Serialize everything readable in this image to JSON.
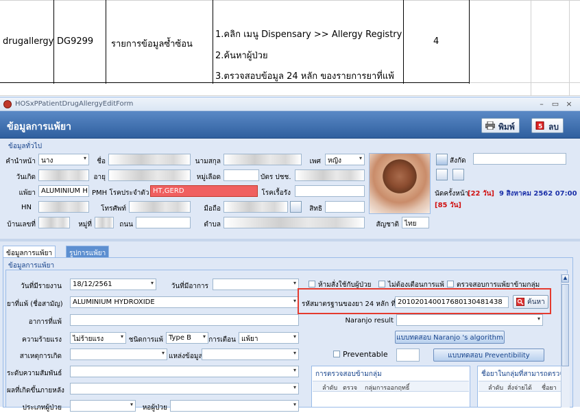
{
  "sheet": {
    "row": {
      "code": "drugallergy",
      "id": "DG9299",
      "description": "รายการข้อมูลซ้ำซ้อน",
      "steps": [
        "1.คลิก เมนู Dispensary >> Allergy Registry",
        "2.ค้นหาผู้ป่วย",
        "3.ตรวจสอบข้อมูล 24 หลัก ของรายการยาที่แพ้"
      ],
      "count": "4"
    }
  },
  "window": {
    "title": "HOSxPPatientDrugAllergyEditForm",
    "controls": {
      "minimize": "–",
      "maximize": "▭",
      "close": "×"
    }
  },
  "header": {
    "title": "ข้อมูลการแพ้ยา",
    "print_label": "พิมพ์",
    "delete_label": "ลบ"
  },
  "general": {
    "section_label": "ข้อมูลทั่วไป",
    "prefix_label": "คำนำหน้า",
    "prefix_value": "นาง",
    "name_label": "ชื่อ",
    "surname_label": "นามสกุล",
    "sex_label": "เพศ",
    "sex_value": "หญิง",
    "status_label": "สังกัด",
    "birthdate_label": "วันเกิด",
    "age_label": "อายุ",
    "village_label": "หมู่เลือด",
    "idcard_label": "บัตร ปชช.",
    "allergy_label": "แพ้ยา",
    "allergy_value": "ALUMINIUM H",
    "pmh_label": "PMH โรคประจำตัว",
    "pmh_value": "HT,GERD",
    "chronic_label": "โรคเรื้อรัง",
    "hn_label": "HN",
    "phone_label": "โทรศัพท์",
    "mobile_label": "มือถือ",
    "rights_label": "สิทธิ",
    "house_label": "บ้านเลขที่",
    "moo_label": "หมู่ที่",
    "road_label": "ถนน",
    "tambon_label": "ตำบล",
    "nationality_label": "สัญชาติ",
    "nationality_value": "ไทย",
    "next_appt_label": "นัดครั้งหน้า",
    "next_appt_days": "[22 วัน]",
    "next_appt_date": "9 สิงหาคม 2562 07:00",
    "next_appt_extra": "[85 วัน]"
  },
  "tabs": {
    "allergy_info": "ข้อมูลการแพ้ยา",
    "allergy_pattern": "รูปการแพ้ยา"
  },
  "allergy": {
    "section_label": "ข้อมูลการแพ้ยา",
    "report_date_label": "วันที่มีรายงาน",
    "report_date_value": "18/12/2561",
    "symptom_date_label": "วันที่มีอาการ",
    "chk_forbid": "ห้ามสั่งใช้กับผู้ป่วย",
    "chk_no_alert": "ไม่ต้องเตือนการแพ้",
    "chk_cross_group": "ตรวจสอบการแพ้ยาข้ามกลุ่ม",
    "drug_label": "ยาที่แพ้ (ชื่อสามัญ)",
    "drug_value": "ALUMINIUM HYDROXIDE",
    "code24_label": "รหัสมาตรฐานของยา 24 หลัก ที่แพ้",
    "code24_value": "201020140017680130481438",
    "search_label": "ค้นหา",
    "symptom_label": "อาการที่แพ้",
    "naranjo_label": "Naranjo result",
    "severity_label": "ความร้ายแรง",
    "severity_value": "ไม่ร้ายแรง",
    "type_label": "ชนิดการแพ้",
    "type_value": "Type B",
    "alert_label": "การเตือน",
    "alert_value": "แพ้ยา",
    "naranjo_btn": "แบบทดสอบ Naranjo 's algorithm",
    "cause_label": "สาเหตุการเกิด",
    "source_label": "แหล่งข้อมูล",
    "preventable_label": "Preventable",
    "preventability_btn": "แบบทดสอบ Preventibility",
    "relation_label": "ระดับความสัมพันธ์",
    "cross_group_title": "การตรวจสอบข้ามกลุ่ม",
    "cross_cols": [
      "ลำดับ",
      "ตรวจ",
      "กลุ่มการออกฤทธิ์"
    ],
    "outcome_label": "ผลที่เกิดขึ้นภายหลัง",
    "same_group_title": "ชื่อยาในกลุ่มที่สามารถตรวจสอบ",
    "same_cols": [
      "ลำดับ",
      "สั่งจ่ายได้",
      "ชื่อยา"
    ],
    "patient_type_label": "ประเภทผู้ป่วย",
    "ward_label": "หอผู้ป่วย"
  }
}
